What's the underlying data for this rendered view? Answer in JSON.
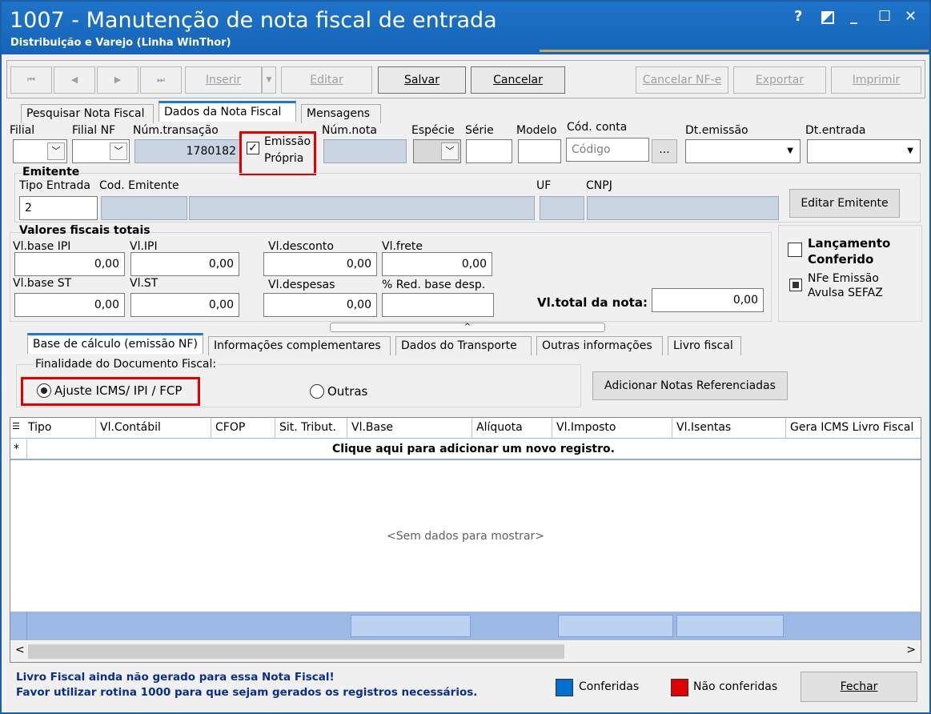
{
  "window": {
    "title": "1007 - Manutenção de nota fiscal de entrada",
    "subtitle": "Distribuição e Varejo (Linha WinThor)",
    "help": "?",
    "minimize": "_",
    "maximize": "☐",
    "close": "✕"
  },
  "toolbar": {
    "first": "⏮",
    "prev": "◀",
    "next": "▶",
    "last": "⏭",
    "insert": "Inserir",
    "edit": "Editar",
    "save": "Salvar",
    "cancel": "Cancelar",
    "cancel_nfe": "Cancelar NF-e",
    "export": "Exportar",
    "print": "Imprimir"
  },
  "tabs": [
    "Pesquisar Nota Fiscal",
    "Dados da Nota Fiscal",
    "Mensagens"
  ],
  "header": {
    "filial": "Filial",
    "filial_nf": "Filial NF",
    "num_transacao": "Núm.transação",
    "num_transacao_value": "1780182",
    "emissao_propria_1": "Emissão",
    "emissao_propria_2": "Própria",
    "num_nota": "Núm.nota",
    "especie": "Espécie",
    "serie": "Série",
    "modelo": "Modelo",
    "cod_conta": "Cód. conta",
    "cod_conta_placeholder": "Código",
    "ellipsis": "...",
    "dt_emissao": "Dt.emissão",
    "dt_entrada": "Dt.entrada"
  },
  "emitente": {
    "title": "Emitente",
    "tipo_entrada": "Tipo Entrada",
    "tipo_entrada_value": "2",
    "cod_emitente": "Cod. Emitente",
    "uf": "UF",
    "cnpj": "CNPJ",
    "edit_button": "Editar Emitente"
  },
  "valores": {
    "title": "Valores fiscais totais",
    "vl_base_ipi": "Vl.base IPI",
    "vl_base_ipi_v": "0,00",
    "vl_ipi": "Vl.IPI",
    "vl_ipi_v": "0,00",
    "vl_desconto": "Vl.desconto",
    "vl_desconto_v": "0,00",
    "vl_frete": "Vl.frete",
    "vl_frete_v": "0,00",
    "vl_base_st": "Vl.base ST",
    "vl_base_st_v": "0,00",
    "vl_st": "Vl.ST",
    "vl_st_v": "0,00",
    "vl_despesas": "Vl.despesas",
    "vl_despesas_v": "0,00",
    "red_base": "% Red. base desp.",
    "vl_total": "Vl.total da nota:",
    "vl_total_v": "0,00"
  },
  "side": {
    "lanc_1": "Lançamento",
    "lanc_2": "Conferido",
    "nfe_1": "NFe Emissão",
    "nfe_2": "Avulsa SEFAZ"
  },
  "subtabs": [
    "Base de cálculo (emissão NF)",
    "Informações complementares",
    "Dados do Transporte",
    "Outras informações",
    "Livro fiscal"
  ],
  "finalidade": {
    "title": "Finalidade do Documento Fiscal:",
    "opt1": "Ajuste ICMS/ IPI / FCP",
    "opt2": "Outras",
    "add_button": "Adicionar Notas Referenciadas"
  },
  "grid": {
    "columns": [
      "Tipo",
      "Vl.Contábil",
      "CFOP",
      "Sit. Tribut.",
      "Vl.Base",
      "Alíquota",
      "Vl.Imposto",
      "Vl.Isentas",
      "Gera ICMS Livro Fiscal"
    ],
    "new_row": "Clique aqui para adicionar um novo registro.",
    "new_row_marker": "*",
    "empty": "<Sem dados para mostrar>"
  },
  "footer": {
    "msg1": "Livro Fiscal ainda não gerado para essa Nota Fiscal!",
    "msg2": "Favor utilizar rotina 1000 para que sejam gerados os registros necessários.",
    "legend_conf": "Conferidas",
    "legend_nconf": "Não conferidas",
    "close": "Fechar",
    "conf_color": "#0070d0",
    "nconf_color": "#e00000"
  }
}
